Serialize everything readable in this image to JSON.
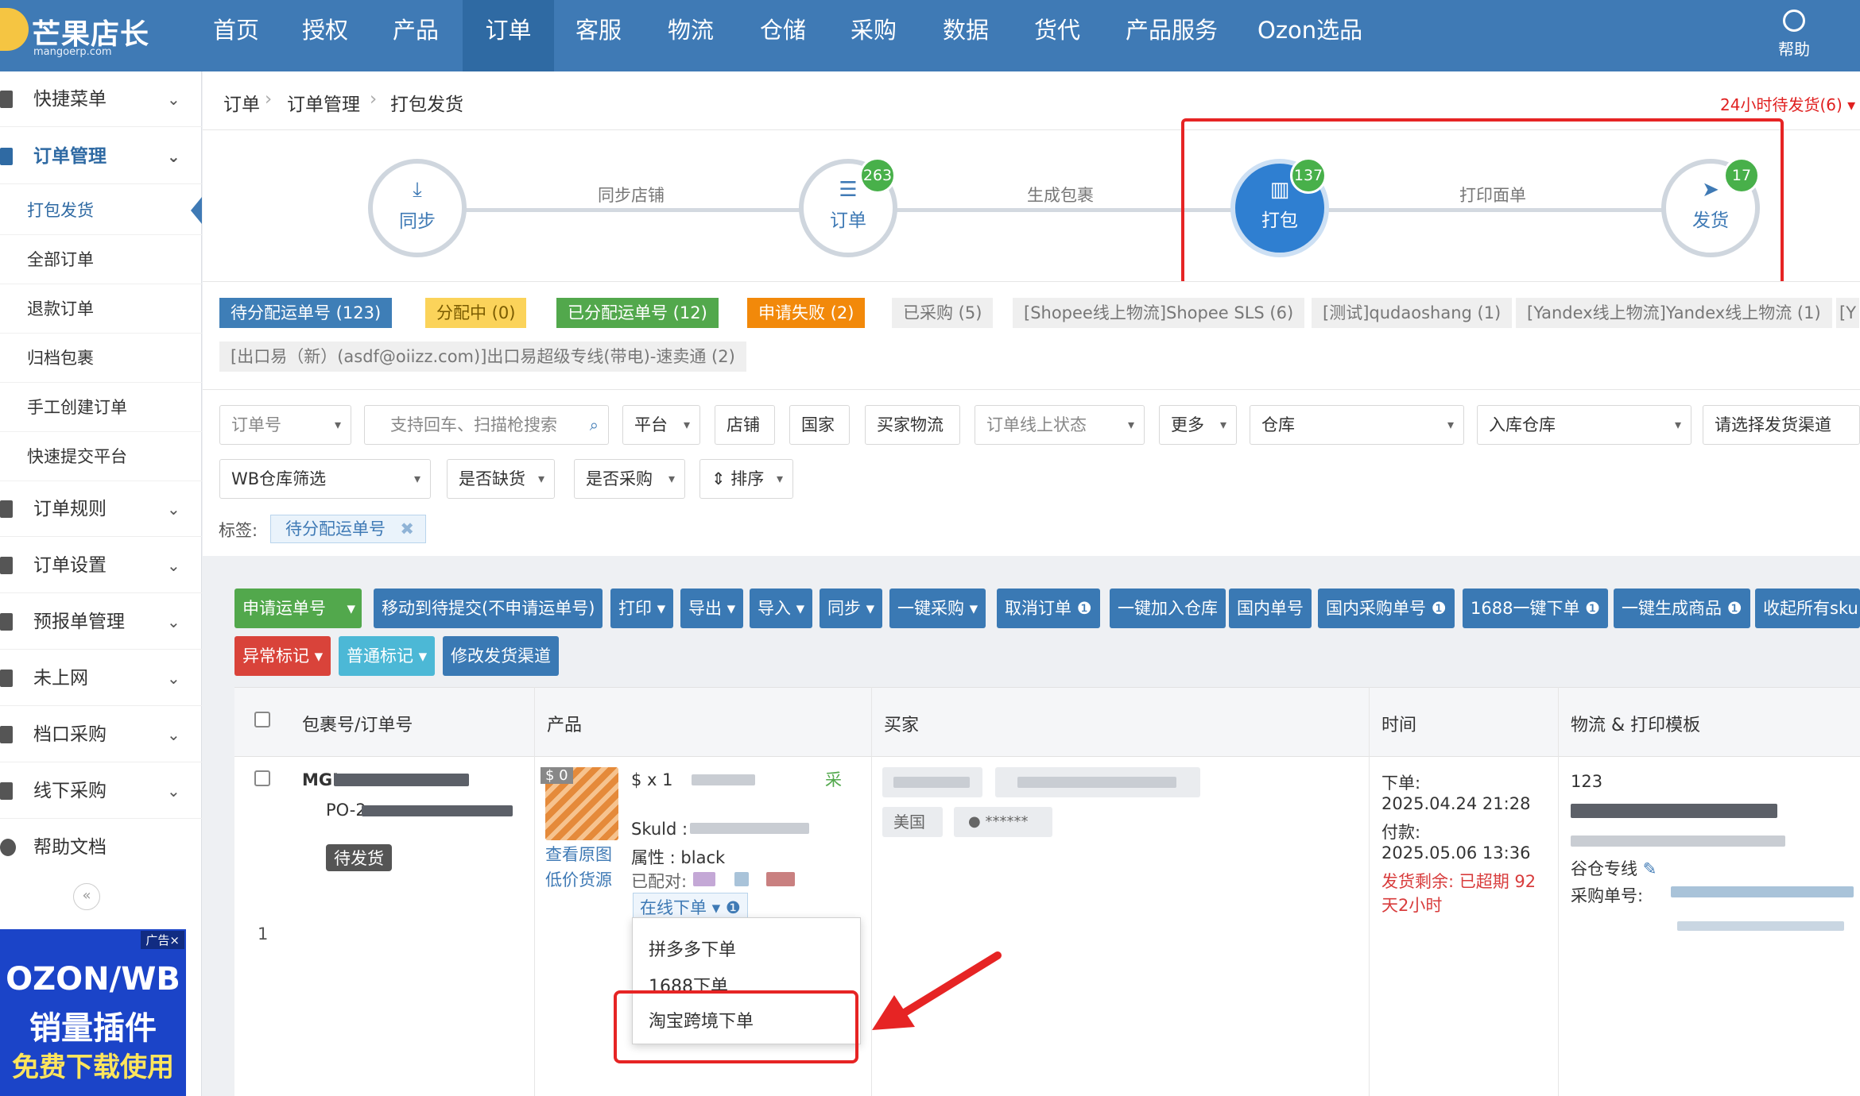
{
  "app": {
    "logo_text": "芒果店长",
    "logo_sub": "mangoerp.com",
    "help_label": "帮助"
  },
  "nav": {
    "items": [
      "首页",
      "授权",
      "产品",
      "订单",
      "客服",
      "物流",
      "仓储",
      "采购",
      "数据",
      "货代",
      "产品服务",
      "Ozon选品"
    ],
    "active": "订单"
  },
  "sidebar": {
    "quick_menu": "快捷菜单",
    "order_mgmt": "订单管理",
    "sub_items": [
      "打包发货",
      "全部订单",
      "退款订单",
      "归档包裹",
      "手工创建订单",
      "快速提交平台"
    ],
    "groups": [
      "订单规则",
      "订单设置",
      "预报单管理",
      "未上网",
      "档口采购",
      "线下采购",
      "帮助文档"
    ],
    "collapse": "«",
    "ad": {
      "tag": "广告×",
      "line1": "OZON/WB",
      "line2": "销量插件",
      "line3": "免费下载使用"
    }
  },
  "breadcrumb": [
    "订单",
    "订单管理",
    "打包发货"
  ],
  "alert24": "24小时待发货(6)",
  "flow": {
    "steps": [
      {
        "label": "同步",
        "badge": ""
      },
      {
        "label": "订单",
        "badge": "263"
      },
      {
        "label": "打包",
        "badge": "137"
      },
      {
        "label": "发货",
        "badge": "17"
      }
    ],
    "connectors": [
      "同步店铺",
      "生成包裹",
      "打印面单"
    ]
  },
  "tags": {
    "row1": [
      "待分配运单号 (123)",
      "分配中 (0)",
      "已分配运单号 (12)",
      "申请失败 (2)",
      "已采购 (5)",
      "[Shopee线上物流]Shopee SLS (6)",
      "[测试]qudaoshang (1)",
      "[Yandex线上物流]Yandex线上物流 (1)",
      "[Y"
    ],
    "row2": [
      "[出口易（新）(asdf@oiizz.com)]出口易超级专线(带电)-速卖通 (2)"
    ]
  },
  "filters": {
    "order_no": "订单号",
    "search_ph": "支持回车、扫描枪搜索",
    "platform": "平台",
    "shop": "店铺",
    "country": "国家",
    "buyer_logistics": "买家物流",
    "online_status": "订单线上状态",
    "more": "更多",
    "warehouse": "仓库",
    "inbound_wh": "入库仓库",
    "ship_channel": "请选择发货渠道",
    "wb_wh": "WB仓库筛选",
    "out_of_stock": "是否缺货",
    "purchased": "是否采购",
    "sort": "排序",
    "label_title": "标签:",
    "label_chip": "待分配运单号"
  },
  "toolbar": {
    "row1": [
      "申请运单号",
      "移动到待提交(不申请运单号)",
      "打印",
      "导出",
      "导入",
      "同步",
      "一键采购",
      "取消订单",
      "一键加入仓库",
      "国内单号",
      "国内采购单号",
      "1688一键下单",
      "一键生成商品",
      "收起所有sku"
    ],
    "row2": [
      "异常标记",
      "普通标记",
      "修改发货渠道"
    ]
  },
  "table": {
    "headers": [
      "包裹号/订单号",
      "产品",
      "买家",
      "时间",
      "物流 & 打印模板"
    ],
    "row": {
      "index": "1",
      "package_prefix": "MGI",
      "order_prefix": "PO-2",
      "status": "待发货",
      "price_badge": "$ 0",
      "view_image": "查看原图",
      "low_price": "低价货源",
      "qty": "$ x 1",
      "purchase_tag": "采",
      "skuid": "Skuld :",
      "attr": "属性 : black",
      "matched": "已配对:",
      "online_order": "在线下单",
      "buyer_country": "美国",
      "buyer_masked": "******",
      "time_order_label": "下单:",
      "time_order": "2025.04.24 21:28",
      "time_paid_label": "付款:",
      "time_paid": "2025.05.06 13:36",
      "ship_remaining": "发货剩余: 已超期 92",
      "ship_remaining2": "天2小时",
      "logistics_id": "123",
      "channel": "谷仓专线",
      "purchase_no": "采购单号:"
    }
  },
  "dropdown": {
    "items": [
      "拼多多下单",
      "1688下单",
      "淘宝跨境下单"
    ]
  }
}
